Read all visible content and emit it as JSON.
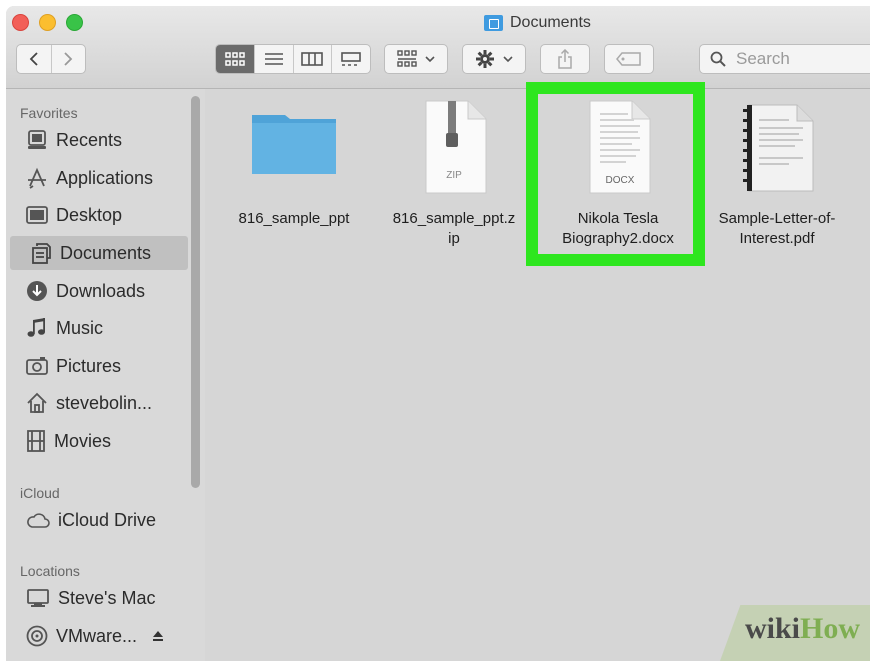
{
  "window": {
    "title": "Documents"
  },
  "toolbar": {
    "back_icon": "chevron-left-icon",
    "forward_icon": "chevron-right-icon",
    "views": [
      "icon-view",
      "list-view",
      "column-view",
      "gallery-view"
    ],
    "active_view": "icon-view",
    "search_placeholder": "Search"
  },
  "sidebar": {
    "favorites_label": "Favorites",
    "favorites": [
      {
        "label": "Recents",
        "icon": "recents-icon"
      },
      {
        "label": "Applications",
        "icon": "applications-icon"
      },
      {
        "label": "Desktop",
        "icon": "desktop-icon"
      },
      {
        "label": "Documents",
        "icon": "documents-icon",
        "selected": true
      },
      {
        "label": "Downloads",
        "icon": "downloads-icon"
      },
      {
        "label": "Music",
        "icon": "music-icon"
      },
      {
        "label": "Pictures",
        "icon": "pictures-icon"
      },
      {
        "label": "stevebolin...",
        "icon": "home-icon"
      },
      {
        "label": "Movies",
        "icon": "movies-icon"
      }
    ],
    "icloud_label": "iCloud",
    "icloud": [
      {
        "label": "iCloud Drive",
        "icon": "cloud-icon"
      }
    ],
    "locations_label": "Locations",
    "locations": [
      {
        "label": "Steve's Mac",
        "icon": "computer-icon"
      },
      {
        "label": "VMware...",
        "icon": "disk-icon"
      }
    ]
  },
  "files": [
    {
      "name_line1": "816_sample_ppt",
      "name_line2": "",
      "type": "folder"
    },
    {
      "name_line1": "816_sample_ppt.z",
      "name_line2": "ip",
      "type": "zip",
      "badge": "ZIP"
    },
    {
      "name_line1": "Nikola Tesla",
      "name_line2": "Biography2.docx",
      "type": "docx",
      "badge": "DOCX",
      "highlighted": true
    },
    {
      "name_line1": "Sample-Letter-of-",
      "name_line2": "Interest.pdf",
      "type": "pdf"
    }
  ],
  "watermark": {
    "part1": "wiki",
    "part2": "How"
  },
  "colors": {
    "highlight": "#2ee61f",
    "folder": "#3f9be0",
    "selection": "#c0c0c0"
  }
}
